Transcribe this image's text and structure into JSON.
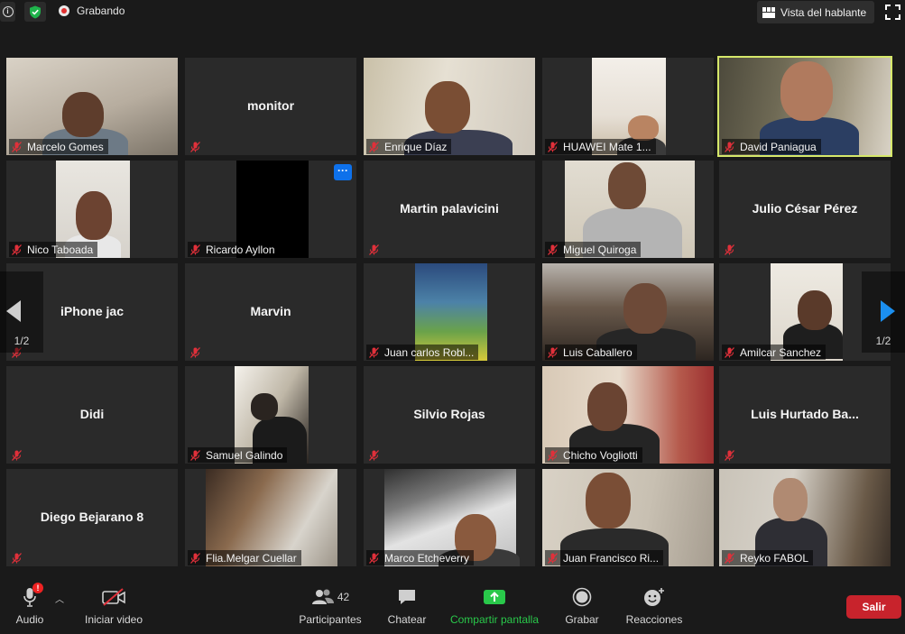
{
  "topbar": {
    "recording_label": "Grabando",
    "view_label": "Vista del hablante"
  },
  "participants": [
    {
      "name": "Marcelo Gomes",
      "display": "video"
    },
    {
      "name": "monitor",
      "display": "name"
    },
    {
      "name": "Enrique Díaz",
      "display": "video"
    },
    {
      "name": "HUAWEI Mate 1...",
      "display": "video"
    },
    {
      "name": "David Paniagua",
      "display": "video",
      "speaking": true
    },
    {
      "name": "Nico Taboada",
      "display": "video"
    },
    {
      "name": "Ricardo Ayllon",
      "display": "video"
    },
    {
      "name": "Martin palavicini",
      "display": "name"
    },
    {
      "name": "Miguel Quiroga",
      "display": "video"
    },
    {
      "name": "Julio César Pérez",
      "display": "name"
    },
    {
      "name": "iPhone jac",
      "display": "name"
    },
    {
      "name": "Marvin",
      "display": "name"
    },
    {
      "name": "Juan carlos Robl...",
      "display": "video"
    },
    {
      "name": "Luis Caballero",
      "display": "video"
    },
    {
      "name": "Amilcar Sanchez",
      "display": "video"
    },
    {
      "name": "Didi",
      "display": "name"
    },
    {
      "name": "Samuel Galindo",
      "display": "video"
    },
    {
      "name": "Silvio Rojas",
      "display": "name"
    },
    {
      "name": "Chicho Vogliotti",
      "display": "video"
    },
    {
      "name": "Luis  Hurtado Ba...",
      "display": "name"
    },
    {
      "name": "Diego Bejarano 8",
      "display": "name"
    },
    {
      "name": "Flia.Melgar Cuellar",
      "display": "video"
    },
    {
      "name": "Marco Etcheverry",
      "display": "video"
    },
    {
      "name": "Juan Francisco Ri...",
      "display": "video"
    },
    {
      "name": "Reyko FABOL",
      "display": "video"
    }
  ],
  "pagination": {
    "prev_page": "1/2",
    "next_page": "1/2"
  },
  "tile_menu_label": "···",
  "toolbar": {
    "audio_label": "Audio",
    "audio_badge": "!",
    "video_label": "Iniciar video",
    "participants_label": "Participantes",
    "participants_count": "42",
    "chat_label": "Chatear",
    "share_label": "Compartir pantalla",
    "record_label": "Grabar",
    "reactions_label": "Reacciones",
    "leave_label": "Salir"
  },
  "colors": {
    "share_green": "#29c84a",
    "leave_red": "#c8232c",
    "speaking_border": "#d6e86a",
    "page_arrow_blue": "#1b8ff0",
    "muted_mic_red": "#e0303a"
  }
}
